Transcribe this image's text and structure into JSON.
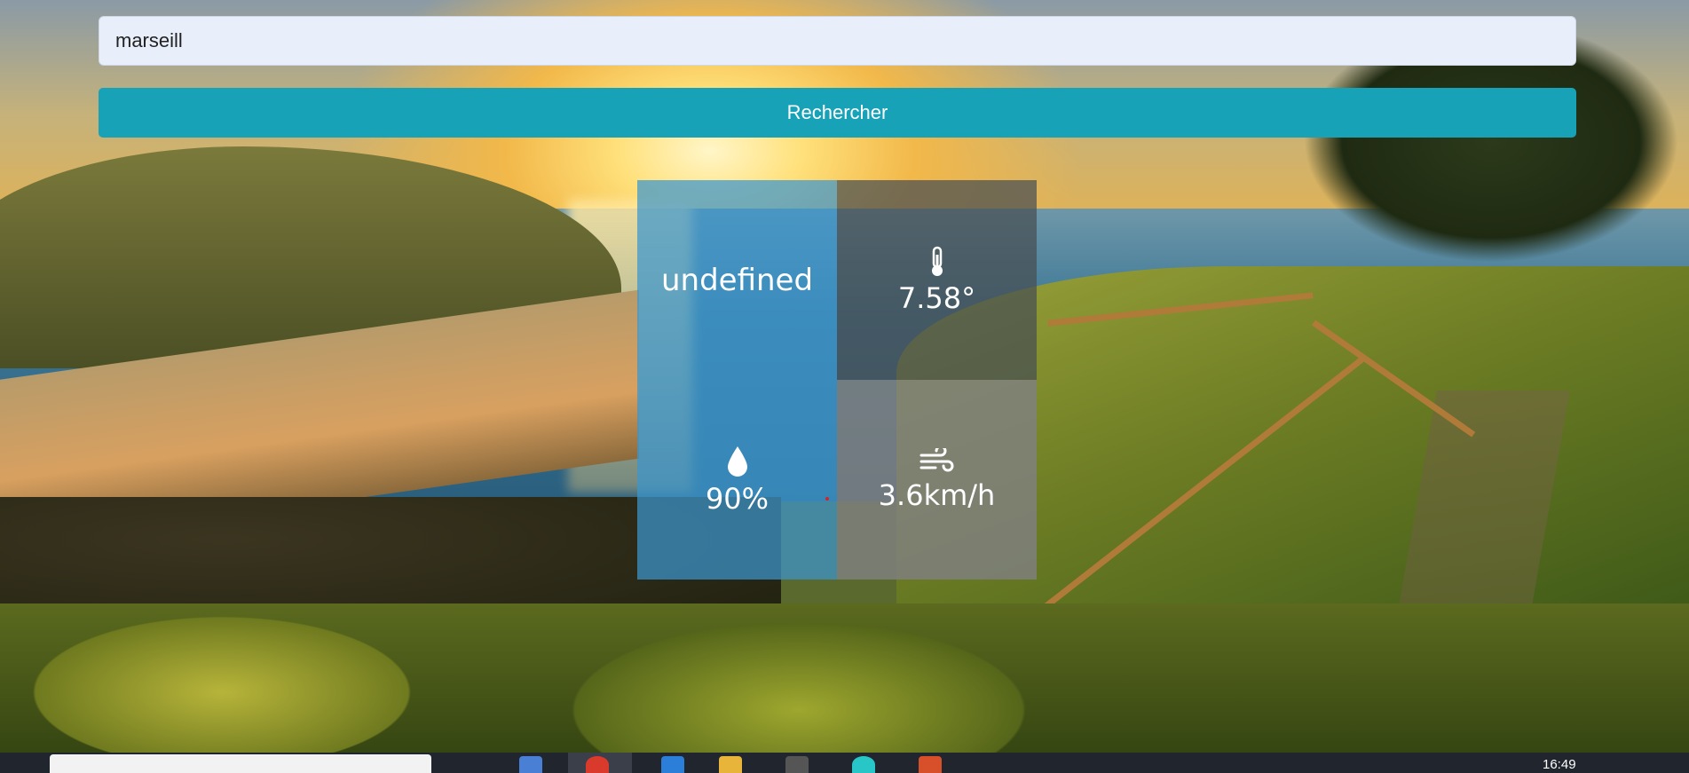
{
  "search": {
    "value": "marseill",
    "button_label": "Rechercher"
  },
  "weather": {
    "city": "undefined",
    "temperature": "7.58°",
    "humidity": "90%",
    "wind": "3.6km/h"
  },
  "icons": {
    "temperature": "thermometer-icon",
    "humidity": "water-drop-icon",
    "wind": "wind-icon"
  },
  "taskbar": {
    "time": "16:49"
  },
  "colors": {
    "accent": "#17a2b8",
    "tile_blue": "#3c96cd",
    "tile_dark": "#464e52",
    "tile_grey": "#808080"
  }
}
